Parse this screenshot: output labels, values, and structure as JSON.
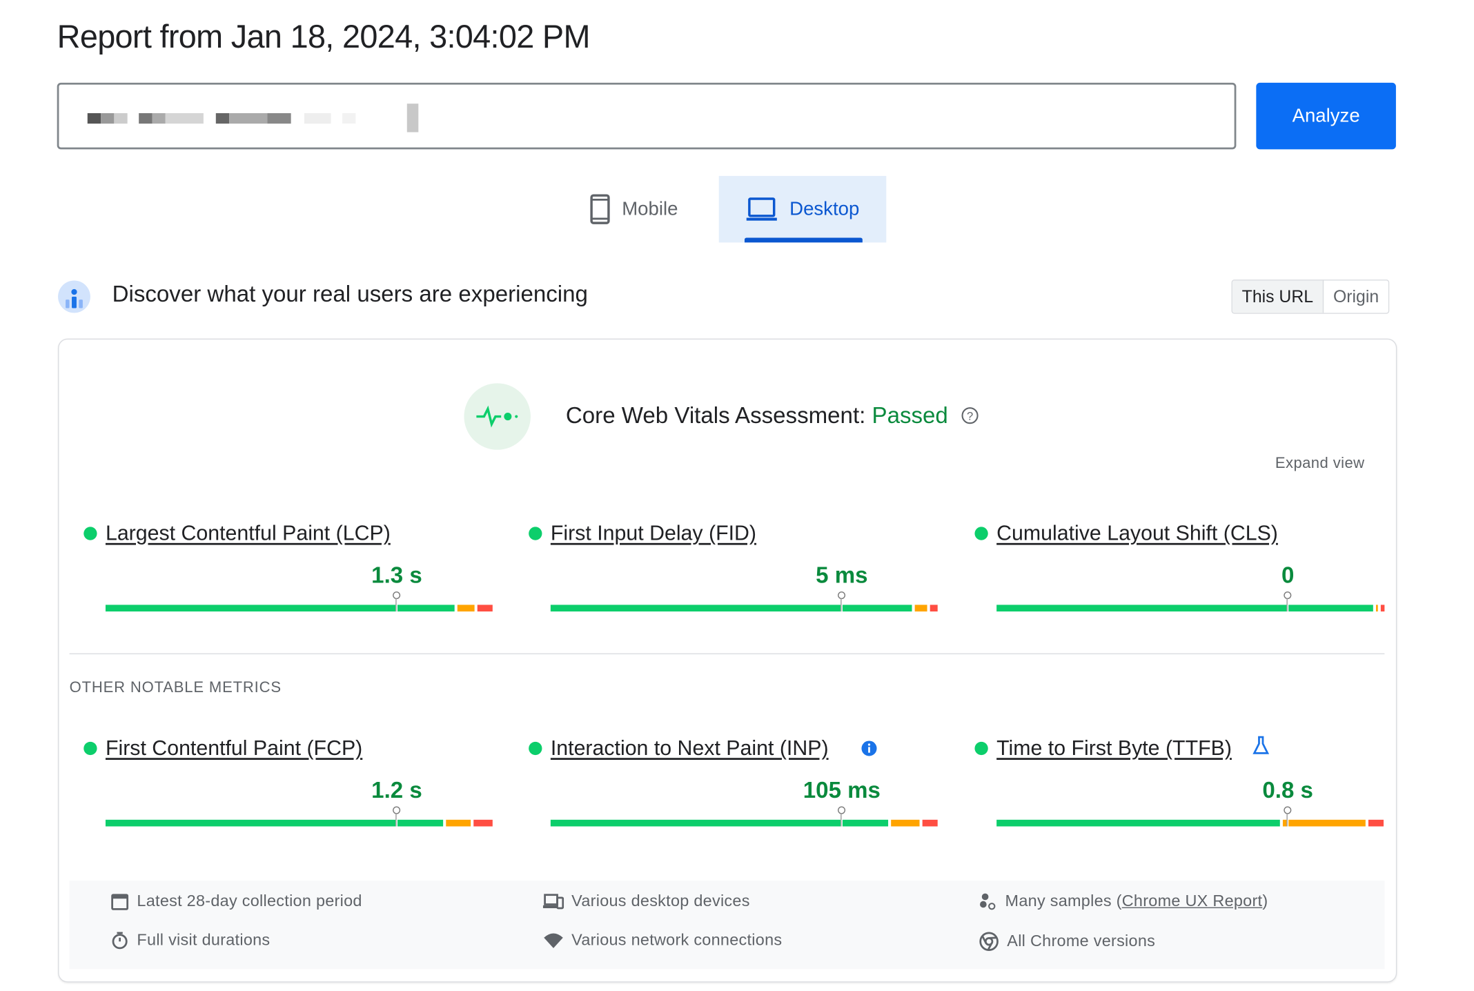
{
  "header": {
    "title": "Report from Jan 18, 2024, 3:04:02 PM"
  },
  "url_input": {
    "value": "",
    "redacted": true
  },
  "analyze_button": {
    "label": "Analyze",
    "color": "#0b6ef5"
  },
  "device_tabs": [
    {
      "label": "Mobile",
      "icon": "phone-icon",
      "selected": false
    },
    {
      "label": "Desktop",
      "icon": "laptop-icon",
      "selected": true
    }
  ],
  "field_data": {
    "heading": "Discover what your real users are experiencing",
    "scope_options": [
      {
        "label": "This URL",
        "selected": true
      },
      {
        "label": "Origin",
        "selected": false
      }
    ],
    "assessment_label": "Core Web Vitals Assessment:",
    "assessment_status": "Passed",
    "expand_label": "Expand view",
    "colors": {
      "good": "#0cce6b",
      "needs_improvement": "#ffa400",
      "poor": "#ff4e42",
      "value_text": "#0a8a3d"
    },
    "core_metrics": [
      {
        "name": "Largest Contentful Paint (LCP)",
        "value": "1.3 s",
        "status": "good",
        "distribution": {
          "good": 91,
          "needs_improvement": 5,
          "poor": 4
        }
      },
      {
        "name": "First Input Delay (FID)",
        "value": "5 ms",
        "status": "good",
        "distribution": {
          "good": 94,
          "needs_improvement": 4,
          "poor": 2
        }
      },
      {
        "name": "Cumulative Layout Shift (CLS)",
        "value": "0",
        "status": "good",
        "distribution": {
          "good": 98,
          "needs_improvement": 1,
          "poor": 1
        }
      }
    ],
    "other_label": "OTHER NOTABLE METRICS",
    "other_metrics": [
      {
        "name": "First Contentful Paint (FCP)",
        "value": "1.2 s",
        "status": "good",
        "distribution": {
          "good": 88,
          "needs_improvement": 7,
          "poor": 5
        }
      },
      {
        "name": "Interaction to Next Paint (INP)",
        "value": "105 ms",
        "status": "good",
        "badge_icon": "info-icon",
        "distribution": {
          "good": 88,
          "needs_improvement": 8,
          "poor": 4
        }
      },
      {
        "name": "Time to First Byte (TTFB)",
        "value": "0.8 s",
        "status": "good",
        "badge_icon": "flask-icon",
        "distribution": {
          "good": 74,
          "needs_improvement": 22,
          "poor": 4
        }
      }
    ],
    "footer": {
      "collection_period": "Latest 28-day collection period",
      "devices": "Various desktop devices",
      "samples_prefix": "Many samples (",
      "samples_link": "Chrome UX Report",
      "samples_suffix": ")",
      "durations": "Full visit durations",
      "network": "Various network connections",
      "chrome_versions": "All Chrome versions"
    }
  }
}
